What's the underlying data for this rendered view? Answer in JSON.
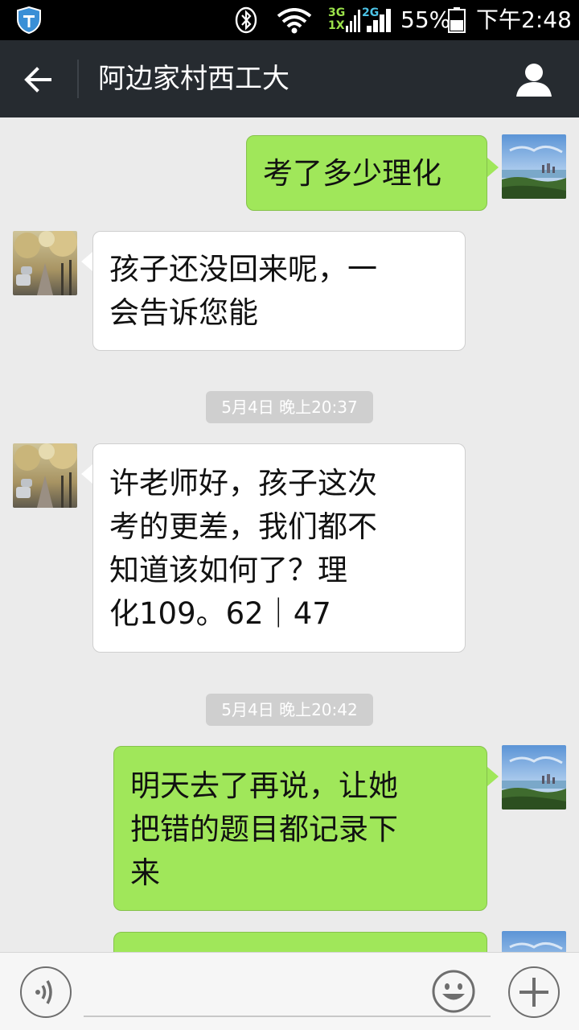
{
  "status_bar": {
    "network_primary": "3G",
    "network_secondary": "1X",
    "network_2g": "2G",
    "battery": "55%",
    "time": "下午2:48",
    "icons": [
      "shield-icon",
      "bluetooth-icon",
      "wifi-icon",
      "signal-icon",
      "battery-icon"
    ]
  },
  "header": {
    "title": "阿边家村西工大",
    "back_icon": "arrow-left-icon",
    "profile_icon": "person-icon"
  },
  "messages": [
    {
      "side": "right",
      "lines": [
        "考了多少理化"
      ]
    },
    {
      "side": "left",
      "lines": [
        "孩子还没回来呢，一",
        "会告诉您能"
      ]
    },
    {
      "timestamp": "5月4日 晚上20:37"
    },
    {
      "side": "left",
      "lines": [
        "许老师好，孩子这次",
        "考的更差，我们都不",
        "知道该如何了？理",
        "化109。62｜47"
      ]
    },
    {
      "timestamp": "5月4日 晚上20:42"
    },
    {
      "side": "right",
      "lines": [
        "明天去了再说，让她",
        "把错的题目都记录下",
        "来"
      ]
    },
    {
      "side": "right",
      "lines": [
        ""
      ]
    }
  ],
  "input_bar": {
    "text_value": "",
    "voice_icon": "voice-icon",
    "emoji_icon": "emoji-icon",
    "plus_icon": "plus-icon"
  },
  "colors": {
    "status_bar": "#000000",
    "title_bar": "#262b30",
    "background": "#ebebeb",
    "sent_bubble": "#a0e75a",
    "received_bubble": "#ffffff",
    "timestamp_bg": "#cfcfcf"
  }
}
